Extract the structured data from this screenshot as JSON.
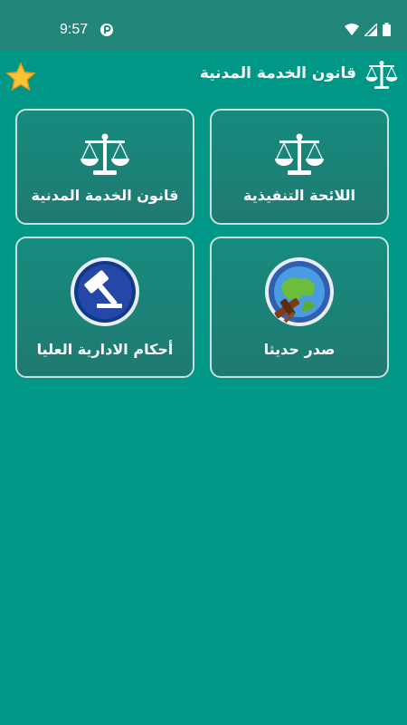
{
  "status_bar": {
    "time": "9:57"
  },
  "app_bar": {
    "title": "قانون الخدمة المدنية"
  },
  "cards": [
    {
      "label": "اللائحة التنفيذية",
      "icon": "scales-icon"
    },
    {
      "label": "قانون الخدمة المدنية",
      "icon": "scales-icon"
    },
    {
      "label": "صدر حديثا",
      "icon": "globe-gavel-icon"
    },
    {
      "label": "أحكام الادارية العليا",
      "icon": "gavel-icon"
    }
  ],
  "colors": {
    "background": "#019786",
    "status_bar": "#22877a",
    "card_border": "#c8e0dc"
  }
}
